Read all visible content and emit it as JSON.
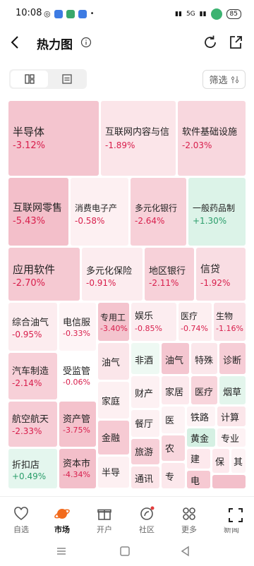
{
  "status_bar": {
    "time": "10:08",
    "signal": "5G",
    "battery": "85"
  },
  "header": {
    "title": "热力图"
  },
  "toolbar": {
    "filter_label": "筛选"
  },
  "colors": {
    "down": "#d81e4c",
    "up": "#2a9d6a"
  },
  "tiles": [
    {
      "name": "半导体",
      "change": "-3.12%"
    },
    {
      "name": "互联网内容与信",
      "change": "-1.89%"
    },
    {
      "name": "软件基础设施",
      "change": "-2.03%"
    },
    {
      "name": "互联网零售",
      "change": "-5.43%"
    },
    {
      "name": "消费电子产",
      "change": "-0.58%"
    },
    {
      "name": "多元化银行",
      "change": "-2.64%"
    },
    {
      "name": "一般药品制",
      "change": "+1.30%"
    },
    {
      "name": "应用软件",
      "change": "-2.70%"
    },
    {
      "name": "多元化保险",
      "change": "-0.91%"
    },
    {
      "name": "地区银行",
      "change": "-2.11%"
    },
    {
      "name": "信贷",
      "change": "-1.92%"
    },
    {
      "name": "综合油气",
      "change": "-0.95%"
    },
    {
      "name": "电信服",
      "change": "-0.33%"
    },
    {
      "name": "专用工",
      "change": "-3.40%"
    },
    {
      "name": "娱乐",
      "change": "-0.85%"
    },
    {
      "name": "医疗",
      "change": "-0.74%"
    },
    {
      "name": "生物",
      "change": "-1.16%"
    },
    {
      "name": "汽车制造",
      "change": "-2.14%"
    },
    {
      "name": "受监管",
      "change": "-0.06%"
    },
    {
      "name": "航空航天",
      "change": "-2.33%"
    },
    {
      "name": "资产管",
      "change": "-3.75%"
    },
    {
      "name": "折扣店",
      "change": "+0.49%"
    },
    {
      "name": "资本市",
      "change": "-4.34%"
    },
    {
      "name": "油气"
    },
    {
      "name": "非酒"
    },
    {
      "name": "油气"
    },
    {
      "name": "特殊"
    },
    {
      "name": "诊断"
    },
    {
      "name": "家庭"
    },
    {
      "name": "财产"
    },
    {
      "name": "家居"
    },
    {
      "name": "医疗"
    },
    {
      "name": "烟草"
    },
    {
      "name": "餐厅"
    },
    {
      "name": "医"
    },
    {
      "name": "铁路"
    },
    {
      "name": "计算"
    },
    {
      "name": "金融"
    },
    {
      "name": "黄金"
    },
    {
      "name": "专业"
    },
    {
      "name": "旅游"
    },
    {
      "name": "农"
    },
    {
      "name": "半导"
    },
    {
      "name": "建"
    },
    {
      "name": "保"
    },
    {
      "name": "其"
    },
    {
      "name": "通讯"
    },
    {
      "name": "专"
    },
    {
      "name": "电"
    }
  ],
  "bottom_nav": [
    {
      "label": "自选",
      "icon": "heart-icon"
    },
    {
      "label": "市场",
      "icon": "planet-icon"
    },
    {
      "label": "开户",
      "icon": "gift-icon"
    },
    {
      "label": "社区",
      "icon": "community-icon"
    },
    {
      "label": "更多",
      "icon": "grid-icon"
    },
    {
      "label": "新闻",
      "icon": "news-icon"
    }
  ]
}
